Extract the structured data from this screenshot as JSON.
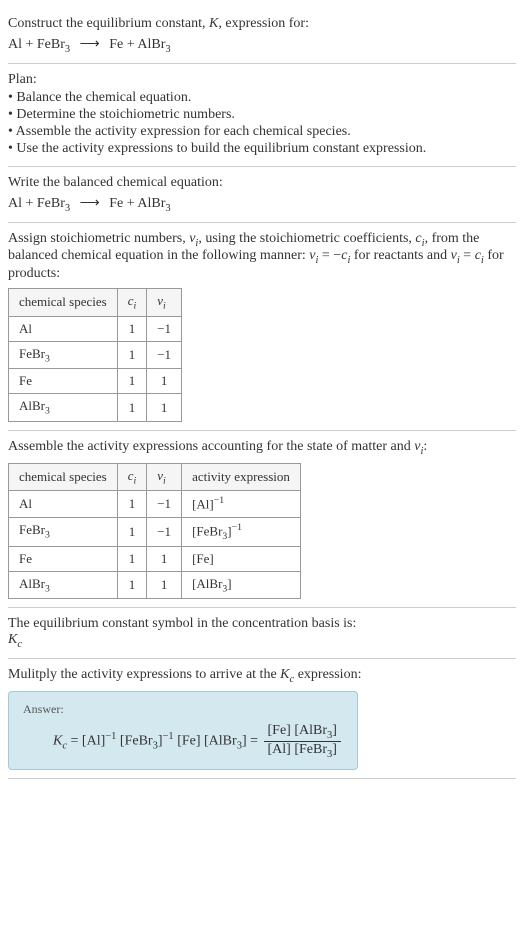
{
  "intro": {
    "prompt": "Construct the equilibrium constant, ",
    "k": "K",
    "prompt2": ", expression for:",
    "eqLeft": "Al + FeBr",
    "eqSub1": "3",
    "arrow": "⟶",
    "eqRight": "Fe + AlBr",
    "eqSub2": "3"
  },
  "plan": {
    "title": "Plan:",
    "items": [
      "• Balance the chemical equation.",
      "• Determine the stoichiometric numbers.",
      "• Assemble the activity expression for each chemical species.",
      "• Use the activity expressions to build the equilibrium constant expression."
    ]
  },
  "balanced": {
    "title": "Write the balanced chemical equation:",
    "eqLeft": "Al + FeBr",
    "eqSub1": "3",
    "arrow": "⟶",
    "eqRight": "Fe + AlBr",
    "eqSub2": "3"
  },
  "stoich": {
    "text1": "Assign stoichiometric numbers, ",
    "nu": "ν",
    "sub_i": "i",
    "text2": ", using the stoichiometric coefficients, ",
    "c": "c",
    "text3": ", from the balanced chemical equation in the following manner: ",
    "eq1": " = −",
    "text4": " for reactants and ",
    "eq2": " = ",
    "text5": " for products:",
    "headers": {
      "species": "chemical species",
      "ci": "c",
      "nui": "ν"
    },
    "rows": [
      {
        "species": "Al",
        "ci": "1",
        "nui": "−1"
      },
      {
        "speciesBase": "FeBr",
        "speciesSub": "3",
        "ci": "1",
        "nui": "−1"
      },
      {
        "species": "Fe",
        "ci": "1",
        "nui": "1"
      },
      {
        "speciesBase": "AlBr",
        "speciesSub": "3",
        "ci": "1",
        "nui": "1"
      }
    ]
  },
  "activity": {
    "text1": "Assemble the activity expressions accounting for the state of matter and ",
    "text2": ":",
    "headers": {
      "species": "chemical species",
      "activity": "activity expression"
    },
    "rows": [
      {
        "species": "Al",
        "ci": "1",
        "nui": "−1",
        "act": "[Al]",
        "actSup": "−1"
      },
      {
        "speciesBase": "FeBr",
        "speciesSub": "3",
        "ci": "1",
        "nui": "−1",
        "actBase": "[FeBr",
        "actSub": "3",
        "actClose": "]",
        "actSup": "−1"
      },
      {
        "species": "Fe",
        "ci": "1",
        "nui": "1",
        "act": "[Fe]"
      },
      {
        "speciesBase": "AlBr",
        "speciesSub": "3",
        "ci": "1",
        "nui": "1",
        "actBase": "[AlBr",
        "actSub": "3",
        "actClose": "]"
      }
    ]
  },
  "kcbasis": {
    "text": "The equilibrium constant symbol in the concentration basis is:",
    "k": "K",
    "sub": "c"
  },
  "multiply": {
    "text1": "Mulitply the activity expressions to arrive at the ",
    "k": "K",
    "sub": "c",
    "text2": " expression:"
  },
  "answer": {
    "label": "Answer:",
    "k": "K",
    "ksub": "c",
    "eq": " = ",
    "t1": "[Al]",
    "s1": "−1",
    "t2": " [FeBr",
    "t2sub": "3",
    "t2close": "]",
    "s2": "−1",
    "t3": " [Fe] [AlBr",
    "t3sub": "3",
    "t3close": "] = ",
    "num1": "[Fe] [AlBr",
    "numSub": "3",
    "numClose": "]",
    "den1": "[Al] [FeBr",
    "denSub": "3",
    "denClose": "]"
  }
}
